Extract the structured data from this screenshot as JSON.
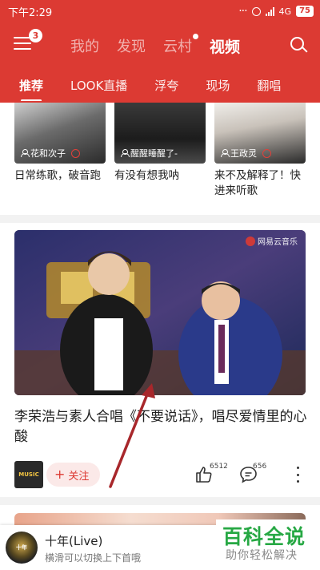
{
  "status_bar": {
    "time": "下午2:29",
    "network": "4G",
    "battery": "75"
  },
  "top_nav": {
    "menu_badge": "3",
    "tabs": [
      {
        "label": "我的",
        "active": false
      },
      {
        "label": "发现",
        "active": false
      },
      {
        "label": "云村",
        "active": false,
        "dot": true
      },
      {
        "label": "视频",
        "active": true
      }
    ],
    "icons": {
      "menu": "hamburger-icon",
      "search": "search-icon"
    }
  },
  "sub_tabs": [
    {
      "label": "推荐",
      "active": true
    },
    {
      "label": "LOOK直播",
      "active": false
    },
    {
      "label": "浮夸",
      "active": false
    },
    {
      "label": "现场",
      "active": false
    },
    {
      "label": "翻唱",
      "active": false
    }
  ],
  "grid_videos": [
    {
      "owner": "花和次子",
      "title": "日常练歌，破音跑",
      "recording": true
    },
    {
      "owner": "醒醒睡醒了-",
      "title": "有没有想我呐",
      "recording": false
    },
    {
      "owner": "王政灵",
      "title": "来不及解释了！快进来听歌",
      "recording": true
    }
  ],
  "featured_video": {
    "brand": "网易云音乐",
    "title": "李荣浩与素人合唱《不要说话》，唱尽爱情里的心酸",
    "author_avatar_text": "MUSIC",
    "follow_label": "关注",
    "likes": "6512",
    "comments": "656"
  },
  "player": {
    "cover_text": "十年",
    "song": "十年(Live)",
    "hint": "横滑可以切换上下首哦"
  },
  "watermark": {
    "title": "百科全说",
    "subtitle": "助你轻松解决"
  },
  "colors": {
    "brand_red": "#dc3a33",
    "watermark_green": "#27a844"
  }
}
